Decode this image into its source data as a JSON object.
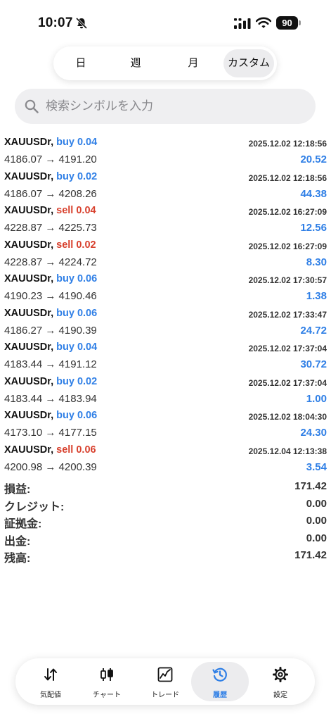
{
  "status_bar": {
    "time": "10:07",
    "battery": "90"
  },
  "period_tabs": [
    {
      "label": "日"
    },
    {
      "label": "週"
    },
    {
      "label": "月"
    },
    {
      "label": "カスタム",
      "selected": true
    }
  ],
  "search": {
    "placeholder": "検索シンボルを入力",
    "value": ""
  },
  "colors": {
    "buy": "#2f7fe6",
    "sell": "#d8412e",
    "profit": "#2f7fe6",
    "active_tab": "#2f7fe6"
  },
  "deals": [
    {
      "symbol": "XAUUSDr,",
      "side": "buy",
      "volume": "0.04",
      "prices": "4186.07 → 4191.20",
      "time": "2025.12.02 12:18:56",
      "profit": "20.52"
    },
    {
      "symbol": "XAUUSDr,",
      "side": "buy",
      "volume": "0.02",
      "prices": "4186.07 → 4208.26",
      "time": "2025.12.02 12:18:56",
      "profit": "44.38"
    },
    {
      "symbol": "XAUUSDr,",
      "side": "sell",
      "volume": "0.04",
      "prices": "4228.87 → 4225.73",
      "time": "2025.12.02 16:27:09",
      "profit": "12.56"
    },
    {
      "symbol": "XAUUSDr,",
      "side": "sell",
      "volume": "0.02",
      "prices": "4228.87 → 4224.72",
      "time": "2025.12.02 16:27:09",
      "profit": "8.30"
    },
    {
      "symbol": "XAUUSDr,",
      "side": "buy",
      "volume": "0.06",
      "prices": "4190.23 → 4190.46",
      "time": "2025.12.02 17:30:57",
      "profit": "1.38"
    },
    {
      "symbol": "XAUUSDr,",
      "side": "buy",
      "volume": "0.06",
      "prices": "4186.27 → 4190.39",
      "time": "2025.12.02 17:33:47",
      "profit": "24.72"
    },
    {
      "symbol": "XAUUSDr,",
      "side": "buy",
      "volume": "0.04",
      "prices": "4183.44 → 4191.12",
      "time": "2025.12.02 17:37:04",
      "profit": "30.72"
    },
    {
      "symbol": "XAUUSDr,",
      "side": "buy",
      "volume": "0.02",
      "prices": "4183.44 → 4183.94",
      "time": "2025.12.02 17:37:04",
      "profit": "1.00"
    },
    {
      "symbol": "XAUUSDr,",
      "side": "buy",
      "volume": "0.06",
      "prices": "4173.10 → 4177.15",
      "time": "2025.12.02 18:04:30",
      "profit": "24.30"
    },
    {
      "symbol": "XAUUSDr,",
      "side": "sell",
      "volume": "0.06",
      "prices": "4200.98 → 4200.39",
      "time": "2025.12.04 12:13:38",
      "profit": "3.54"
    }
  ],
  "summary": [
    {
      "label": "損益:",
      "value": "171.42"
    },
    {
      "label": "クレジット:",
      "value": "0.00"
    },
    {
      "label": "証拠金:",
      "value": "0.00"
    },
    {
      "label": "出金:",
      "value": "0.00"
    },
    {
      "label": "残高:",
      "value": "171.42"
    }
  ],
  "tab_bar": [
    {
      "label": "気配値",
      "icon": "quotes-arrows-icon"
    },
    {
      "label": "チャート",
      "icon": "candlestick-chart-icon"
    },
    {
      "label": "トレード",
      "icon": "trade-line-chart-icon"
    },
    {
      "label": "履歴",
      "icon": "history-clock-icon",
      "active": true
    },
    {
      "label": "設定",
      "icon": "gear-icon"
    }
  ]
}
